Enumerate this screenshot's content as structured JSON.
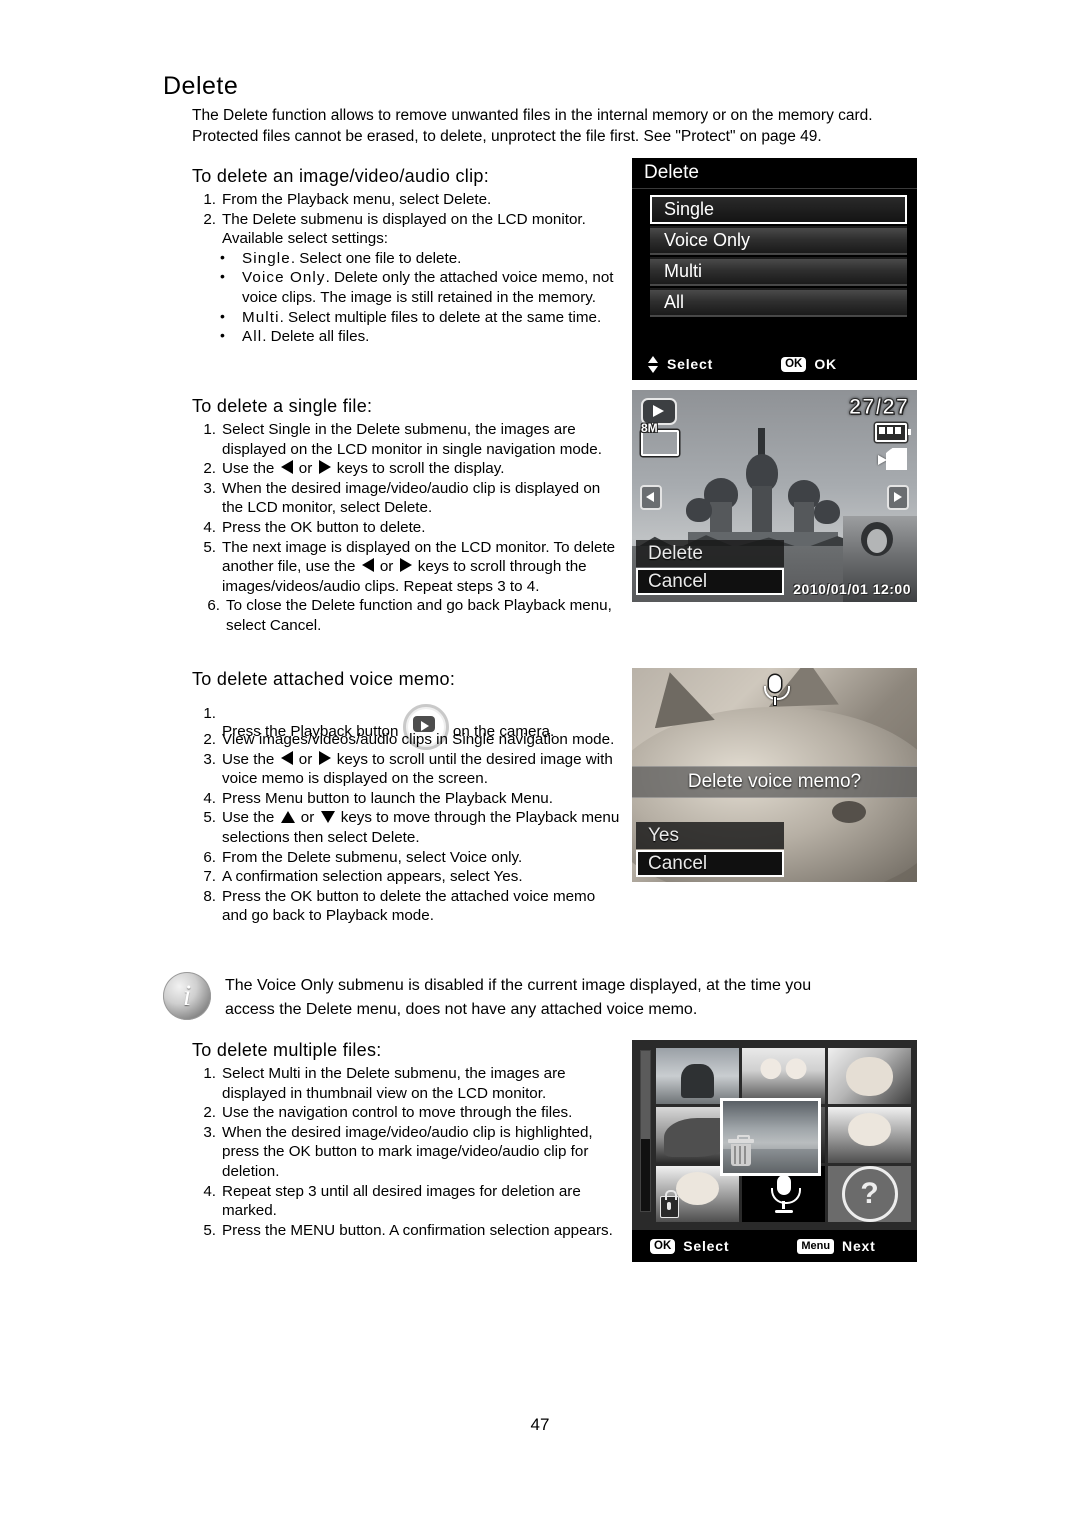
{
  "document": {
    "title": "Delete",
    "page_number": "47",
    "intro_lines": [
      "The Delete function allows to remove unwanted files in the internal memory or on the memory card.",
      "Protected files cannot be erased, to delete, unprotect the file first. See \"Protect\" on page 49."
    ]
  },
  "section_clip": {
    "heading": "To delete an image/video/audio clip:",
    "steps": [
      {
        "num": "1.",
        "text": "From the Playback menu, select Delete."
      },
      {
        "num": "2.",
        "text": "The Delete submenu is displayed on the LCD monitor. Available select settings:"
      }
    ],
    "bullets": [
      {
        "term": "Single",
        "text": ". Select one file to delete."
      },
      {
        "term": "Voice Only",
        "text": ". Delete only the attached voice memo, not voice clips. The image is still retained in the memory."
      },
      {
        "term": "Multi",
        "text": ". Select multiple files to delete at the same time."
      },
      {
        "term": "All",
        "text": ". Delete all files."
      }
    ]
  },
  "section_single": {
    "heading": "To delete a single file:",
    "steps": [
      {
        "num": "1.",
        "text": "Select Single in the Delete submenu, the images are displayed on the LCD monitor in single navigation mode."
      },
      {
        "num": "2.",
        "pre": "Use the ",
        "mid": " or ",
        "post": " keys to scroll the display.",
        "arrows": "lr"
      },
      {
        "num": "3.",
        "text": "When the desired image/video/audio clip is displayed on the LCD monitor, select Delete."
      },
      {
        "num": "4.",
        "text": "Press the OK button to delete."
      },
      {
        "num": "5.",
        "pre": "The next image is displayed on the LCD monitor. To delete another file, use the ",
        "mid": " or ",
        "post": " keys to scroll through the images/videos/audio clips. Repeat steps 3 to 4.",
        "arrows": "lr"
      },
      {
        "num": "6.",
        "text": "To close the Delete function and go back Playback menu, select Cancel."
      }
    ]
  },
  "section_memo": {
    "heading": "To delete attached voice memo:",
    "steps": [
      {
        "num": "1.",
        "pre": "Press the Playback button ",
        "post": " on the camera.",
        "icon": "playback-button-icon"
      },
      {
        "num": "2.",
        "text": "View images/videos/audio clips in Single navigation mode."
      },
      {
        "num": "3.",
        "pre": "Use the ",
        "mid": " or ",
        "post": " keys to scroll until the desired image with voice memo is displayed on the screen.",
        "arrows": "lr"
      },
      {
        "num": "4.",
        "text": "Press Menu button to launch the Playback Menu."
      },
      {
        "num": "5.",
        "pre": "Use the ",
        "mid": " or ",
        "post": " keys to move through the Playback menu selections then select Delete.",
        "arrows": "ud"
      },
      {
        "num": "6.",
        "text": "From the Delete submenu, select Voice only."
      },
      {
        "num": "7.",
        "text": "A confirmation selection appears, select Yes."
      },
      {
        "num": "8.",
        "text": "Press the OK button to delete the attached voice memo and go back to Playback mode."
      }
    ]
  },
  "note": {
    "icon": "info-icon",
    "lines": [
      "The Voice Only submenu is disabled if the current image displayed, at the time you",
      "access the Delete menu, does not have any attached voice memo."
    ]
  },
  "section_multi": {
    "heading": "To delete multiple files:",
    "steps": [
      {
        "num": "1.",
        "text": "Select Multi in the Delete submenu, the images are displayed in thumbnail view on the LCD monitor."
      },
      {
        "num": "2.",
        "text": "Use the navigation control to move through the files."
      },
      {
        "num": "3.",
        "text": "When the desired image/video/audio clip is highlighted, press the OK button to mark image/video/audio clip for deletion."
      },
      {
        "num": "4.",
        "text": "Repeat step 3 until all desired images for deletion are marked."
      },
      {
        "num": "5.",
        "text": "Press the MENU button. A confirmation selection appears."
      }
    ]
  },
  "screens": {
    "delete_menu": {
      "title": "Delete",
      "items": [
        {
          "label": "Single",
          "selected": true
        },
        {
          "label": "Voice Only",
          "selected": false
        },
        {
          "label": "Multi",
          "selected": false
        },
        {
          "label": "All",
          "selected": false
        }
      ],
      "footer": {
        "select_label": "Select",
        "ok_badge": "OK",
        "ok_label": "OK"
      }
    },
    "photo_view": {
      "counter": "27/27",
      "resolution": "8M",
      "options": [
        {
          "label": "Delete",
          "selected": false
        },
        {
          "label": "Cancel",
          "selected": true
        }
      ],
      "datestamp": "2010/01/01  12:00"
    },
    "voice_memo": {
      "prompt": "Delete voice memo?",
      "options": [
        {
          "label": "Yes",
          "selected": false
        },
        {
          "label": "Cancel",
          "selected": true
        }
      ]
    },
    "thumbnail_grid": {
      "footer": {
        "ok_badge": "OK",
        "select_label": "Select",
        "menu_badge": "Menu",
        "next_label": "Next"
      }
    }
  }
}
